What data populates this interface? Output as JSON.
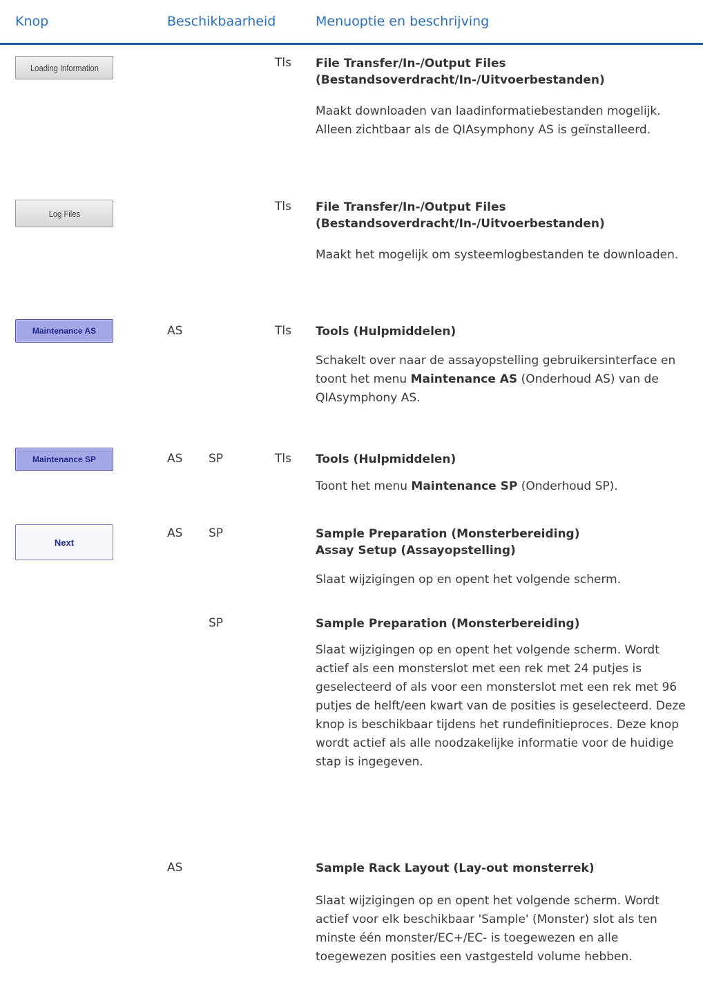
{
  "header": {
    "col_button": "Knop",
    "col_availability": "Beschikbaarheid",
    "col_menu": "Menuoptie en beschrijving"
  },
  "rows": [
    {
      "button": "Loading Information",
      "tls": "Tls",
      "title": "File Transfer/In-/Output Files\n(Bestandsoverdracht/In-/Uitvoerbestanden)",
      "desc": "Maakt downloaden van laadinformatiebestanden mogelijk. Alleen zichtbaar als de QIAsymphony AS is geïnstalleerd."
    },
    {
      "button": "Log Files",
      "tls": "Tls",
      "title": "File Transfer/In-/Output Files\n(Bestandsoverdracht/In-/Uitvoerbestanden)",
      "desc": "Maakt het mogelijk om systeemlogbestanden te downloaden."
    },
    {
      "button": "Maintenance AS",
      "as": "AS",
      "tls": "Tls",
      "title": "Tools (Hulpmiddelen)",
      "desc_pre": "Schakelt over naar de assayopstelling gebruikersinterface en toont het menu ",
      "desc_bold": "Maintenance AS",
      "desc_post": " (Onderhoud AS) van de QIAsymphony AS."
    },
    {
      "button": "Maintenance SP",
      "as": "AS",
      "sp": "SP",
      "tls": "Tls",
      "title": "Tools (Hulpmiddelen)",
      "desc_pre": "Toont het menu ",
      "desc_bold": "Maintenance SP",
      "desc_post": " (Onderhoud SP)."
    },
    {
      "button": "Next",
      "as": "AS",
      "sp": "SP",
      "title": "Sample Preparation (Monsterbereiding)\nAssay Setup (Assayopstelling)",
      "desc": "Slaat wijzigingen op en opent het volgende scherm."
    },
    {
      "sp": "SP",
      "title": "Sample Preparation (Monsterbereiding)",
      "desc": "Slaat wijzigingen op en opent het volgende scherm. Wordt actief als een monsterslot met een rek met 24 putjes is geselecteerd of als voor een monsterslot met een rek met 96 putjes de helft/een kwart van de posities is geselecteerd. Deze knop is beschikbaar tijdens het rundefinitieproces. Deze knop wordt actief als alle noodzakelijke informatie voor de huidige stap is ingegeven."
    },
    {
      "as": "AS",
      "title": "Sample Rack Layout (Lay-out monsterrek)",
      "desc": "Slaat wijzigingen op en opent het volgende scherm. Wordt actief voor elk beschikbaar 'Sample' (Monster) slot als ten minste één monster/EC+/EC- is toegewezen en alle toegewezen posities een vastgesteld volume hebben."
    }
  ]
}
